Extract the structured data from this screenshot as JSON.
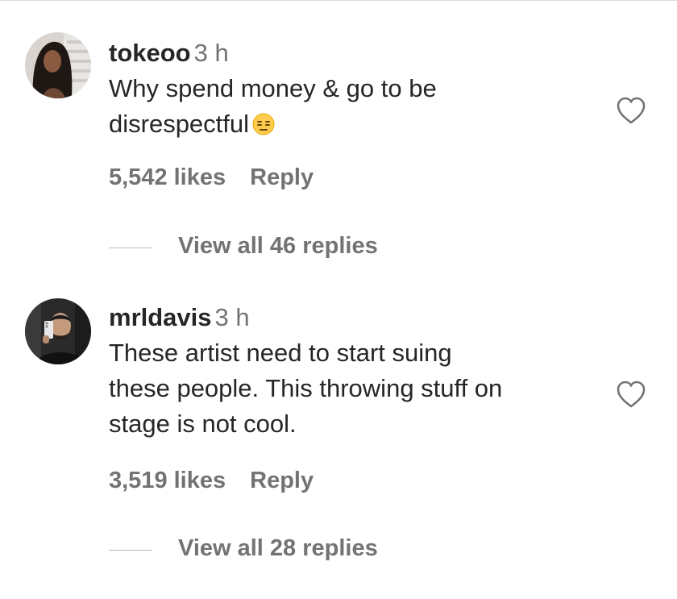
{
  "comments": [
    {
      "username": "tokeoo",
      "time": "3 h",
      "lines": [
        "Why spend money & go to be",
        "disrespectful"
      ],
      "emoji": "expressionless-face-emoji",
      "likes": "5,542 likes",
      "reply_label": "Reply",
      "view_replies": "View all 46 replies",
      "avatar_icon": "profile-photo-woman"
    },
    {
      "username": "mrldavis",
      "time": "3 h",
      "lines": [
        "These artist need to start suing",
        "these people. This throwing stuff on",
        "stage is not cool."
      ],
      "likes": "3,519 likes",
      "reply_label": "Reply",
      "view_replies": "View all 28 replies",
      "avatar_icon": "profile-photo-man-mirror-selfie"
    }
  ],
  "icons": {
    "like": "heart-outline-icon"
  },
  "colors": {
    "text": "#262626",
    "secondary": "#737373",
    "divider": "#dbdbdb"
  }
}
